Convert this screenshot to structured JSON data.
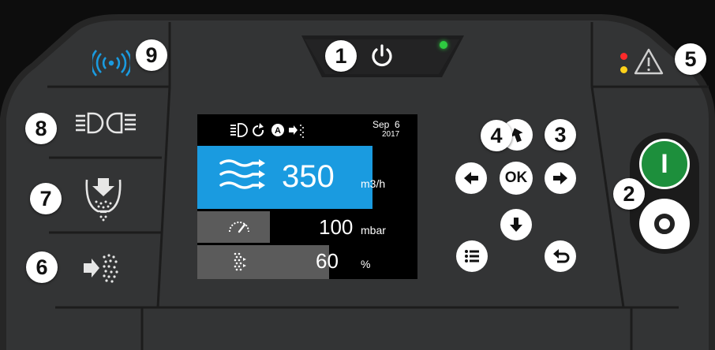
{
  "callouts": {
    "c1": "1",
    "c2": "2",
    "c3": "3",
    "c4": "4",
    "c5": "5",
    "c6": "6",
    "c7": "7",
    "c8": "8",
    "c9": "9"
  },
  "screen": {
    "date_line1": "Sep  6",
    "date_line2": "2017",
    "airflow": {
      "value": "350",
      "unit": "m3/h"
    },
    "pressure": {
      "value": "100",
      "unit": "mbar",
      "fill_fraction": 0.33
    },
    "spray": {
      "value": "60",
      "unit": "%",
      "fill_fraction": 0.6
    },
    "status_icons": [
      "headlight-icon",
      "cycle-icon",
      "auto-icon",
      "spray-icon"
    ]
  },
  "buttons": {
    "ok_label": "OK",
    "start_label": "I"
  },
  "colors": {
    "accent_blue": "#1a9be0",
    "led_green": "#2ecc40",
    "led_red": "#ff2a2a",
    "led_yellow": "#ffd11a",
    "start_green": "#1d8f3c"
  }
}
